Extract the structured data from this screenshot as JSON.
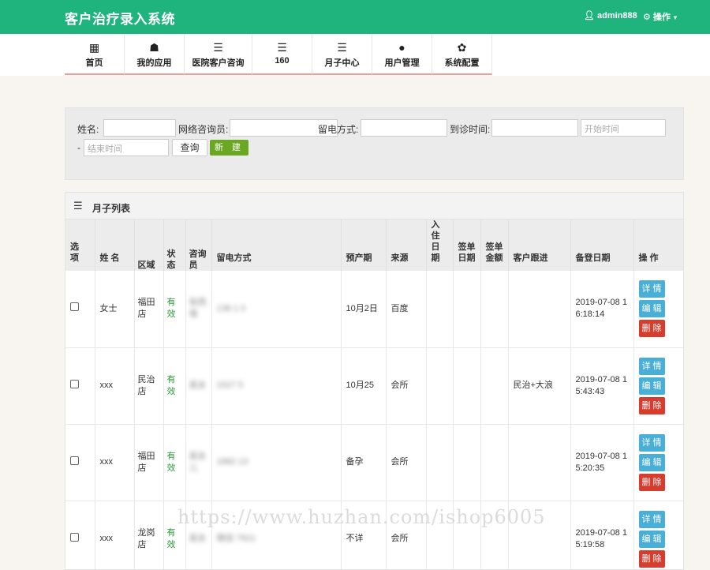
{
  "header": {
    "title": "客户治疗录入系统",
    "user": "admin888",
    "ops": "操作"
  },
  "nav": [
    {
      "label": "首页",
      "icon": "grid-icon",
      "glyph": "▦",
      "w": 76
    },
    {
      "label": "我的应用",
      "icon": "user-group-icon",
      "glyph": "☗",
      "w": 76
    },
    {
      "label": "医院客户咨询",
      "icon": "list-icon",
      "glyph": "☰",
      "w": 86
    },
    {
      "label": "160",
      "icon": "list-icon",
      "glyph": "☰",
      "w": 76
    },
    {
      "label": "月子中心",
      "icon": "list-icon",
      "glyph": "☰",
      "w": 76
    },
    {
      "label": "用户管理",
      "icon": "user-icon",
      "glyph": "●",
      "w": 76
    },
    {
      "label": "系统配置",
      "icon": "gear-icon",
      "glyph": "✿",
      "w": 76
    }
  ],
  "search": {
    "name_label": "姓名:",
    "consultant_label": "网络咨询员:",
    "contact_label": "留电方式:",
    "visit_label": "到诊时间:",
    "start_placeholder": "开始时间",
    "dash": "-",
    "end_placeholder": "结束时间",
    "query_label": "查询",
    "new_label": "新 建"
  },
  "panel": {
    "title": "月子列表"
  },
  "columns": [
    "选 项",
    "姓 名",
    "区域",
    "状态",
    "咨询员",
    "留电方式",
    "预产期",
    "来源",
    "入住日期",
    "签单日期",
    "签单金额",
    "客户跟进",
    "备登日期",
    "操 作"
  ],
  "ops": {
    "detail": "详 情",
    "edit": "编 辑",
    "del": "删 除"
  },
  "rows": [
    {
      "name": "女士",
      "area": "福田店",
      "status": "有效",
      "consultant": "张西增",
      "contact": "138 1 0",
      "due": "10月2日",
      "source": "百度",
      "checkin": "",
      "signdate": "",
      "amount": "",
      "follow": "",
      "regdate": "2019-07-08 16:18:14"
    },
    {
      "name": "xxx",
      "area": "民治店",
      "status": "有效",
      "consultant": "吴女",
      "contact": "1527 5",
      "due": "10月25",
      "source": "会所",
      "checkin": "",
      "signdate": "",
      "amount": "",
      "follow": "民治+大浪",
      "regdate": "2019-07-08 15:43:43"
    },
    {
      "name": "xxx",
      "area": "福田店",
      "status": "有效",
      "consultant": "吴女儿",
      "contact": "1882 13",
      "due": "备孕",
      "source": "会所",
      "checkin": "",
      "signdate": "",
      "amount": "",
      "follow": "",
      "regdate": "2019-07-08 15:20:35"
    },
    {
      "name": "xxx",
      "area": "龙岗店",
      "status": "有效",
      "consultant": "吴女",
      "contact": "微信 7921",
      "due": "不详",
      "source": "会所",
      "checkin": "",
      "signdate": "",
      "amount": "",
      "follow": "",
      "regdate": "2019-07-08 15:19:58"
    }
  ],
  "watermark": "https://www.huzhan.com/ishop6005"
}
